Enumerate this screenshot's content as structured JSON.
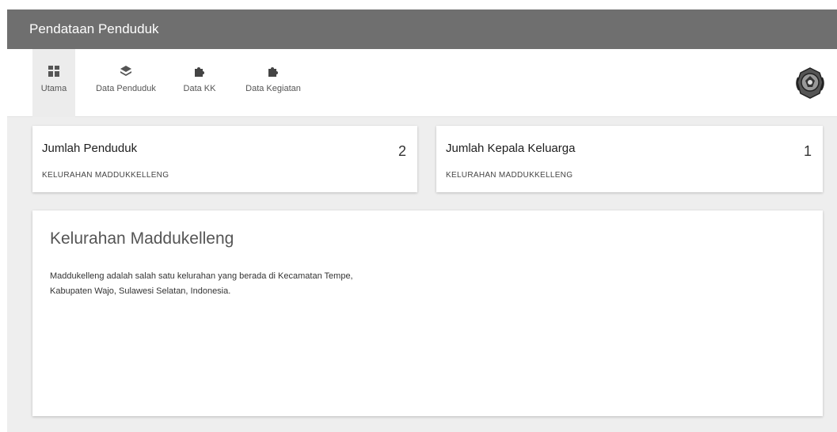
{
  "header": {
    "title": "Pendataan Penduduk"
  },
  "nav": {
    "items": [
      {
        "label": "Utama",
        "icon": "dashboard-icon",
        "active": true
      },
      {
        "label": "Data Penduduk",
        "icon": "layers-icon",
        "active": false
      },
      {
        "label": "Data KK",
        "icon": "puzzle-icon",
        "active": false
      },
      {
        "label": "Data Kegiatan",
        "icon": "puzzle-icon",
        "active": false
      }
    ]
  },
  "stats": [
    {
      "title": "Jumlah Penduduk",
      "subtitle": "KELURAHAN MADDUKKELLENG",
      "value": "2"
    },
    {
      "title": "Jumlah Kepala Keluarga",
      "subtitle": "KELURAHAN MADDUKKELLENG",
      "value": "1"
    }
  ],
  "info": {
    "title": "Kelurahan Maddukelleng",
    "description": "Maddukelleng adalah salah satu kelurahan yang berada di Kecamatan Tempe, Kabupaten Wajo, Sulawesi Selatan, Indonesia."
  },
  "colors": {
    "header_bg": "#6f6f6f",
    "page_bg": "#eeeeee",
    "card_bg": "#ffffff"
  }
}
